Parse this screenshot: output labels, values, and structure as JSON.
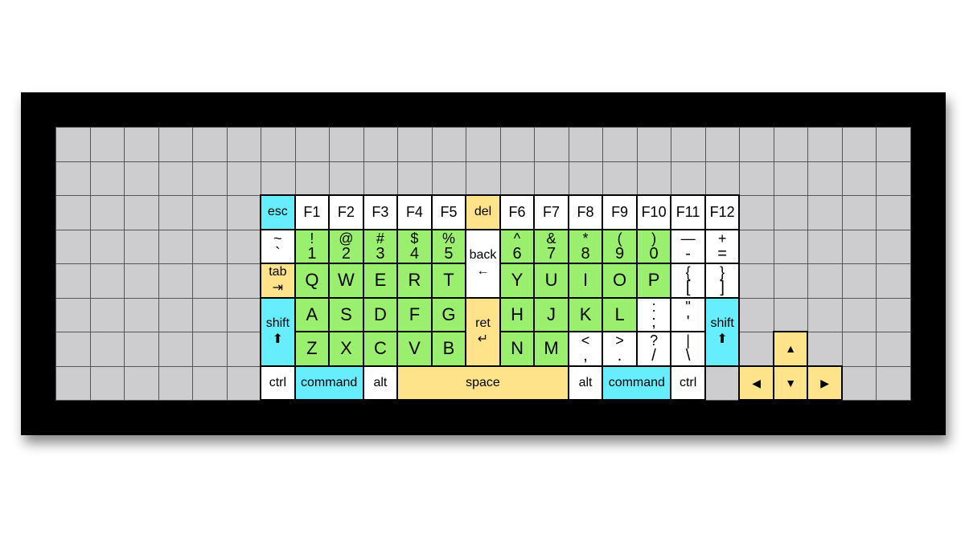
{
  "colors": {
    "cyan": "#66eeff",
    "green": "#9af06e",
    "yellow": "#ffe38a",
    "white": "#ffffff",
    "gray": "#cdcdcf",
    "frame": "#000000"
  },
  "keyboard": {
    "function_row": {
      "esc": "esc",
      "f1": "F1",
      "f2": "F2",
      "f3": "F3",
      "f4": "F4",
      "f5": "F5",
      "del": "del",
      "f6": "F6",
      "f7": "F7",
      "f8": "F8",
      "f9": "F9",
      "f10": "F10",
      "f11": "F11",
      "f12": "F12"
    },
    "number_row": [
      {
        "top": "~",
        "bottom": "`"
      },
      {
        "top": "!",
        "bottom": "1"
      },
      {
        "top": "@",
        "bottom": "2"
      },
      {
        "top": "#",
        "bottom": "3"
      },
      {
        "top": "$",
        "bottom": "4"
      },
      {
        "top": "%",
        "bottom": "5"
      },
      {
        "top": "^",
        "bottom": "6"
      },
      {
        "top": "&",
        "bottom": "7"
      },
      {
        "top": "*",
        "bottom": "8"
      },
      {
        "top": "(",
        "bottom": "9"
      },
      {
        "top": ")",
        "bottom": "0"
      },
      {
        "top": "—",
        "bottom": "-"
      },
      {
        "top": "+",
        "bottom": "="
      }
    ],
    "back": {
      "label": "back",
      "glyph": "←"
    },
    "tab": {
      "label": "tab",
      "glyph": "⇥"
    },
    "qwerty_row": [
      "Q",
      "W",
      "E",
      "R",
      "T",
      "Y",
      "U",
      "I",
      "O",
      "P"
    ],
    "bracket_keys": [
      {
        "top": "{",
        "bottom": "["
      },
      {
        "top": "}",
        "bottom": "]"
      }
    ],
    "shift": {
      "label": "shift",
      "glyph": "⬆"
    },
    "home_row": [
      "A",
      "S",
      "D",
      "F",
      "G",
      "H",
      "J",
      "K",
      "L"
    ],
    "ret": {
      "label": "ret",
      "glyph": "↵"
    },
    "home_punct": [
      {
        "top": ":",
        "bottom": ";"
      },
      {
        "top": "\"",
        "bottom": "'"
      }
    ],
    "bottom_letter_row": [
      "Z",
      "X",
      "C",
      "V",
      "B",
      "N",
      "M"
    ],
    "bottom_punct": [
      {
        "top": "<",
        "bottom": ","
      },
      {
        "top": ">",
        "bottom": "."
      },
      {
        "top": "?",
        "bottom": "/"
      },
      {
        "top": "|",
        "bottom": "\\"
      }
    ],
    "modifier_row": {
      "ctrl": "ctrl",
      "command": "command",
      "alt": "alt",
      "space": "space"
    },
    "arrows": {
      "up": "▲",
      "left": "◀",
      "down": "▼",
      "right": "▶"
    }
  }
}
